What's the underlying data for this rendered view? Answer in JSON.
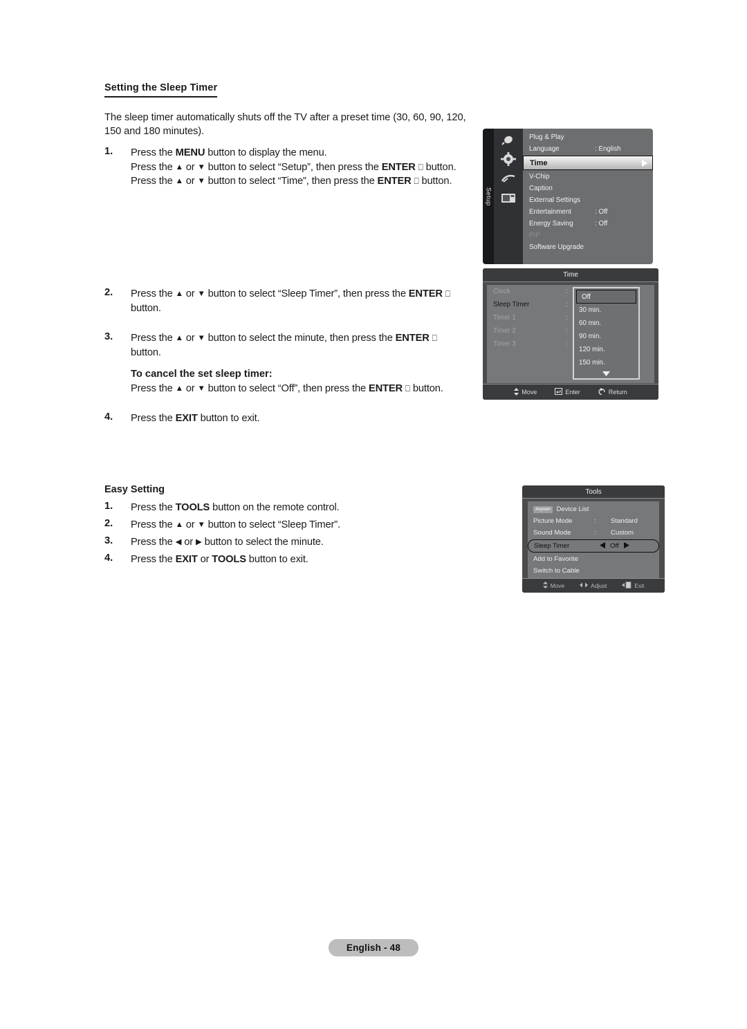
{
  "document": {
    "section_title": "Setting the Sleep Timer",
    "intro": "The sleep timer automatically shuts off the TV after a preset time (30, 60, 90, 120, 150 and 180 minutes).",
    "steps": [
      {
        "num": "1.",
        "lines": [
          "Press the MENU button to display the menu.",
          "Press the ▲ or ▼ button to select “Setup”, then press the ENTER ⏎ button.",
          "Press the ▲ or ▼ button to select “Time”, then press the ENTER ⏎ button."
        ]
      },
      {
        "num": "2.",
        "lines": [
          "Press the ▲ or ▼ button to select “Sleep Timer”, then press the ENTER ⏎",
          "button."
        ]
      },
      {
        "num": "3.",
        "lines": [
          "Press the ▲ or ▼ button to select the minute, then press the ENTER ⏎",
          "button."
        ],
        "subheading": "To cancel the set sleep timer:",
        "subline": "Press the ▲ or ▼ button to select “Off”, then press the ENTER ⏎ button."
      },
      {
        "num": "4.",
        "lines": [
          "Press the EXIT button to exit."
        ]
      }
    ],
    "easy_setting": {
      "title": "Easy Setting",
      "steps": [
        {
          "num": "1.",
          "text": "Press the TOOLS button on the remote control."
        },
        {
          "num": "2.",
          "text": "Press the ▲ or ▼ button to select “Sleep Timer”."
        },
        {
          "num": "3.",
          "text": "Press the ◀ or ▶ button to select the minute."
        },
        {
          "num": "4.",
          "text": "Press the EXIT or TOOLS button to exit."
        }
      ]
    },
    "footer": {
      "page_label": "English - 48"
    }
  },
  "setup_menu": {
    "tab_label": "Setup",
    "sidebar_icons": [
      "input-source-icon",
      "setup-gear-icon",
      "channel-antenna-icon",
      "picture-screen-icon"
    ],
    "items": [
      {
        "label": "Plug & Play",
        "value": "",
        "state": "normal"
      },
      {
        "label": "Language",
        "value": ": English",
        "state": "normal"
      },
      {
        "label": "Time",
        "value": "",
        "state": "selected"
      },
      {
        "label": "V-Chip",
        "value": "",
        "state": "normal"
      },
      {
        "label": "Caption",
        "value": "",
        "state": "normal"
      },
      {
        "label": "External Settings",
        "value": "",
        "state": "normal"
      },
      {
        "label": "Entertainment",
        "value": ": Off",
        "state": "normal"
      },
      {
        "label": "Energy Saving",
        "value": ": Off",
        "state": "normal"
      },
      {
        "label": "PIP",
        "value": "",
        "state": "disabled"
      },
      {
        "label": "Software Upgrade",
        "value": "",
        "state": "normal"
      }
    ]
  },
  "time_menu": {
    "title": "Time",
    "items": [
      {
        "label": "Clock",
        "state": "disabled"
      },
      {
        "label": "Sleep Timer",
        "state": "selected"
      },
      {
        "label": "Timer 1",
        "state": "disabled"
      },
      {
        "label": "Timer 2",
        "state": "disabled"
      },
      {
        "label": "Timer 3",
        "state": "disabled"
      }
    ],
    "dropdown": {
      "options": [
        "Off",
        "30 min.",
        "60 min.",
        "90 min.",
        "120 min.",
        "150 min."
      ],
      "highlighted": "Off",
      "more_indicator": "▼"
    },
    "bottom_bar": [
      {
        "icon": "up-down-arrows-icon",
        "label": "Move"
      },
      {
        "icon": "enter-icon",
        "label": "Enter"
      },
      {
        "icon": "return-icon",
        "label": "Return"
      }
    ]
  },
  "tools_menu": {
    "title": "Tools",
    "items": [
      {
        "label": "Device List",
        "badge": "Anynet+",
        "colon": "",
        "value": "",
        "state": "normal"
      },
      {
        "label": "Picture Mode",
        "colon": ":",
        "value": "Standard",
        "state": "normal"
      },
      {
        "label": "Sound Mode",
        "colon": ":",
        "value": "Custom",
        "state": "normal"
      },
      {
        "label": "Sleep Timer",
        "colon": "",
        "value": "Off",
        "state": "selected"
      },
      {
        "label": "Add to Favorite",
        "colon": "",
        "value": "",
        "state": "normal"
      },
      {
        "label": "Switch to Cable",
        "colon": "",
        "value": "",
        "state": "normal"
      }
    ],
    "bottom_bar": [
      {
        "icon": "up-down-arrows-icon",
        "label": "Move"
      },
      {
        "icon": "left-right-arrows-icon",
        "label": "Adjust"
      },
      {
        "icon": "exit-door-icon",
        "label": "Exit"
      }
    ]
  }
}
